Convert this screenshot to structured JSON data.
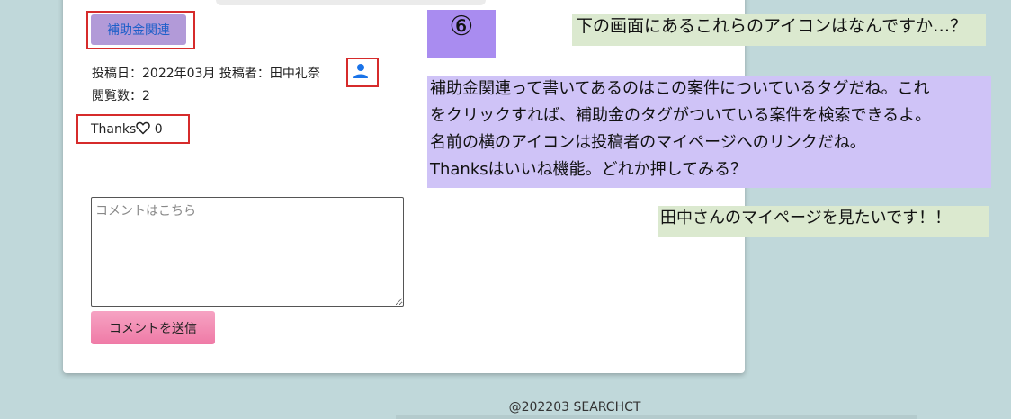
{
  "post": {
    "tag_label": "補助金関連",
    "meta_line": "投稿日：2022年03月 投稿者：田中礼奈",
    "views_line": "閲覧数：2",
    "thanks_label": "Thanks",
    "thanks_count": "0"
  },
  "comment": {
    "placeholder": "コメントはこちら",
    "submit_label": "コメントを送信"
  },
  "tutorial": {
    "step_badge": "⑥",
    "question": "下の画面にあるこれらのアイコンはなんですか…？",
    "answer_lines": [
      "補助金関連って書いてあるのはこの案件についているタグだね。これ",
      "をクリックすれば、補助金のタグがついている案件を検索できるよ。",
      "名前の横のアイコンは投稿者のマイページへのリンクだね。",
      "Thanksはいいね機能。どれか押してみる？"
    ],
    "user_reply": "田中さんのマイページを見たいです！！"
  },
  "footer": {
    "text": "@202203 SEARCHCT"
  },
  "colors": {
    "background": "#c0d8da",
    "tag_button": "#b29ad8",
    "highlight": "#d62b2b",
    "user_icon": "#1a73e8",
    "step_badge": "#a98cf0",
    "answer_bubble": "#cfc3f7",
    "green_bubble": "#dbe9cf",
    "send_button": "#ef7aa6"
  },
  "icons": {
    "user_link": "user-icon",
    "thanks": "heart-outline-icon"
  }
}
